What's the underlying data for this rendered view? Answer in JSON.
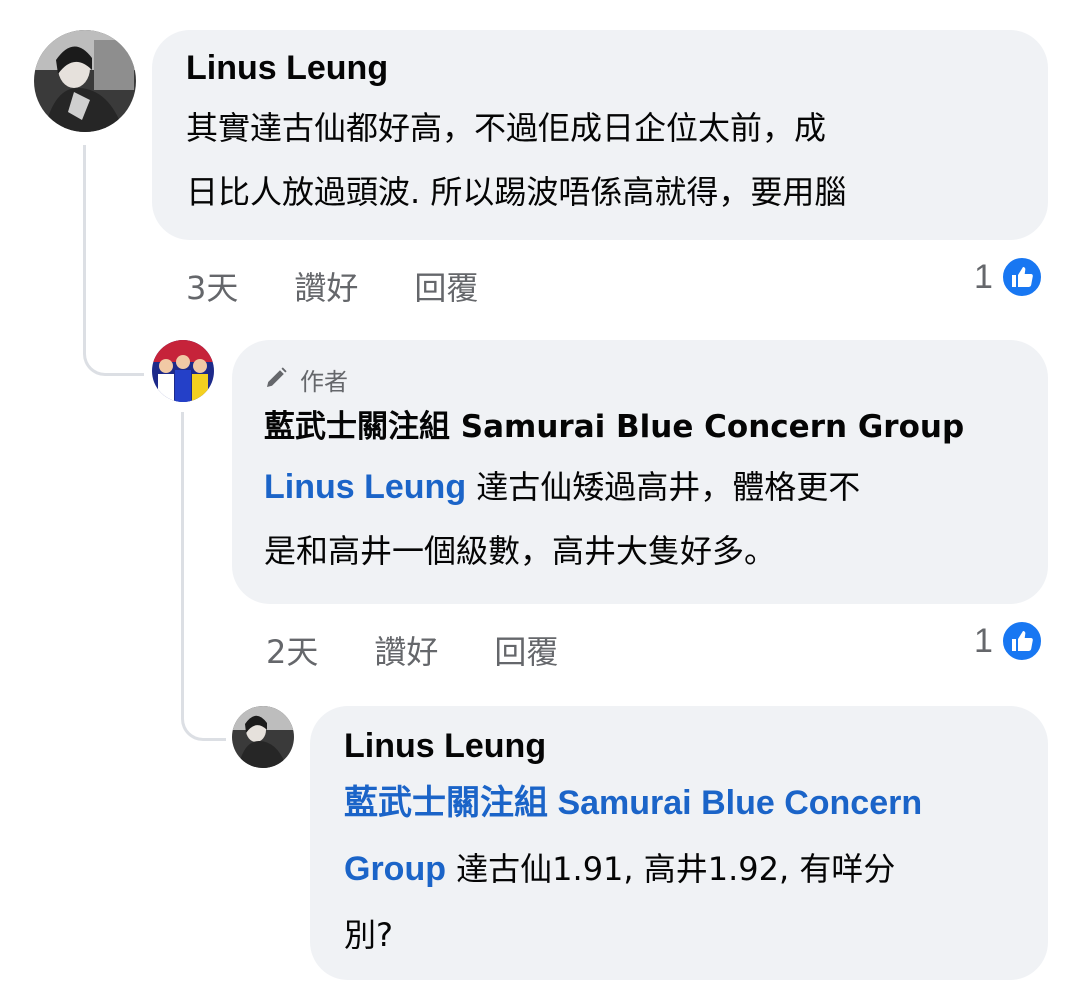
{
  "comments": [
    {
      "author": "Linus Leung",
      "text_line1": "其實達古仙都好高，不過佢成日企位太前，成",
      "text_line2": "日比人放過頭波. 所以踢波唔係高就得，要用腦",
      "time": "3天",
      "like_label": "讚好",
      "reply_label": "回覆",
      "like_count": "1"
    },
    {
      "author_tag": "作者",
      "author": "藍武士關注組 Samurai Blue Concern Group",
      "mention": "Linus Leung",
      "text_line1": " 達古仙矮過高井，體格更不",
      "text_line2": "是和高井一個級數，高井大隻好多。",
      "time": "2天",
      "like_label": "讚好",
      "reply_label": "回覆",
      "like_count": "1"
    },
    {
      "author": "Linus Leung",
      "mention_line1_cjk": "藍武士關注組",
      "mention_line1_latin": " Samurai Blue Concern",
      "mention_line2": "Group",
      "text_line2": " 達古仙1.91, 高井1.92, 有咩分",
      "text_line3": "別?"
    }
  ],
  "icons": {
    "like": "thumbs-up-icon",
    "pencil": "pencil-icon"
  },
  "colors": {
    "bubble": "#f0f2f5",
    "mention": "#1b64c8",
    "like_badge": "#1877f2",
    "meta_text": "#65676b"
  }
}
